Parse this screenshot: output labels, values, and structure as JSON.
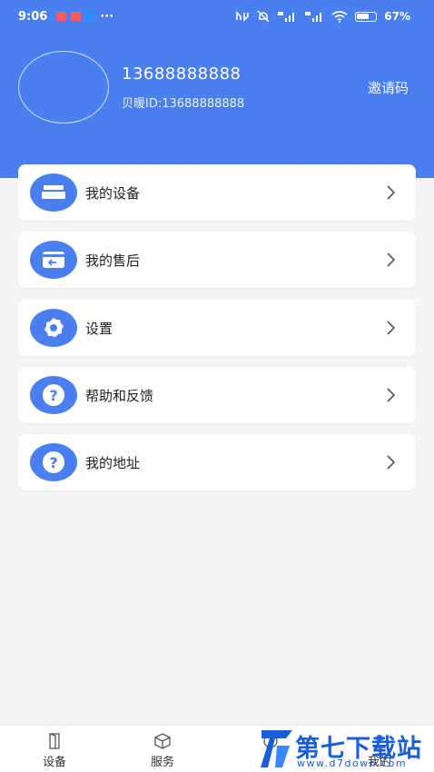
{
  "status_bar": {
    "time": "9:06",
    "battery": "67%",
    "battery_level": 0.67
  },
  "profile": {
    "phone": "13688888888",
    "user_id": "贝暖ID:13688888888",
    "invite_label": "邀请码"
  },
  "menu": {
    "items": [
      {
        "label": "我的设备",
        "icon": "device-icon"
      },
      {
        "label": "我的售后",
        "icon": "after-sales-icon"
      },
      {
        "label": "设置",
        "icon": "gear-icon"
      },
      {
        "label": "帮助和反馈",
        "icon": "help-icon"
      },
      {
        "label": "我的地址",
        "icon": "help-icon"
      }
    ]
  },
  "tabbar": {
    "tabs": [
      {
        "label": "设备",
        "icon": "door-icon"
      },
      {
        "label": "服务",
        "icon": "cube-icon"
      },
      {
        "label": "",
        "icon": "service-icon"
      },
      {
        "label": "我的",
        "icon": "user-icon"
      }
    ]
  },
  "watermark": {
    "main": "第七下载站",
    "sub": "www.d7down.com"
  },
  "colors": {
    "brand_blue": "#4a7ff0",
    "page_bg": "#f5f5f5",
    "watermark_blue": "#1a5dd8"
  }
}
